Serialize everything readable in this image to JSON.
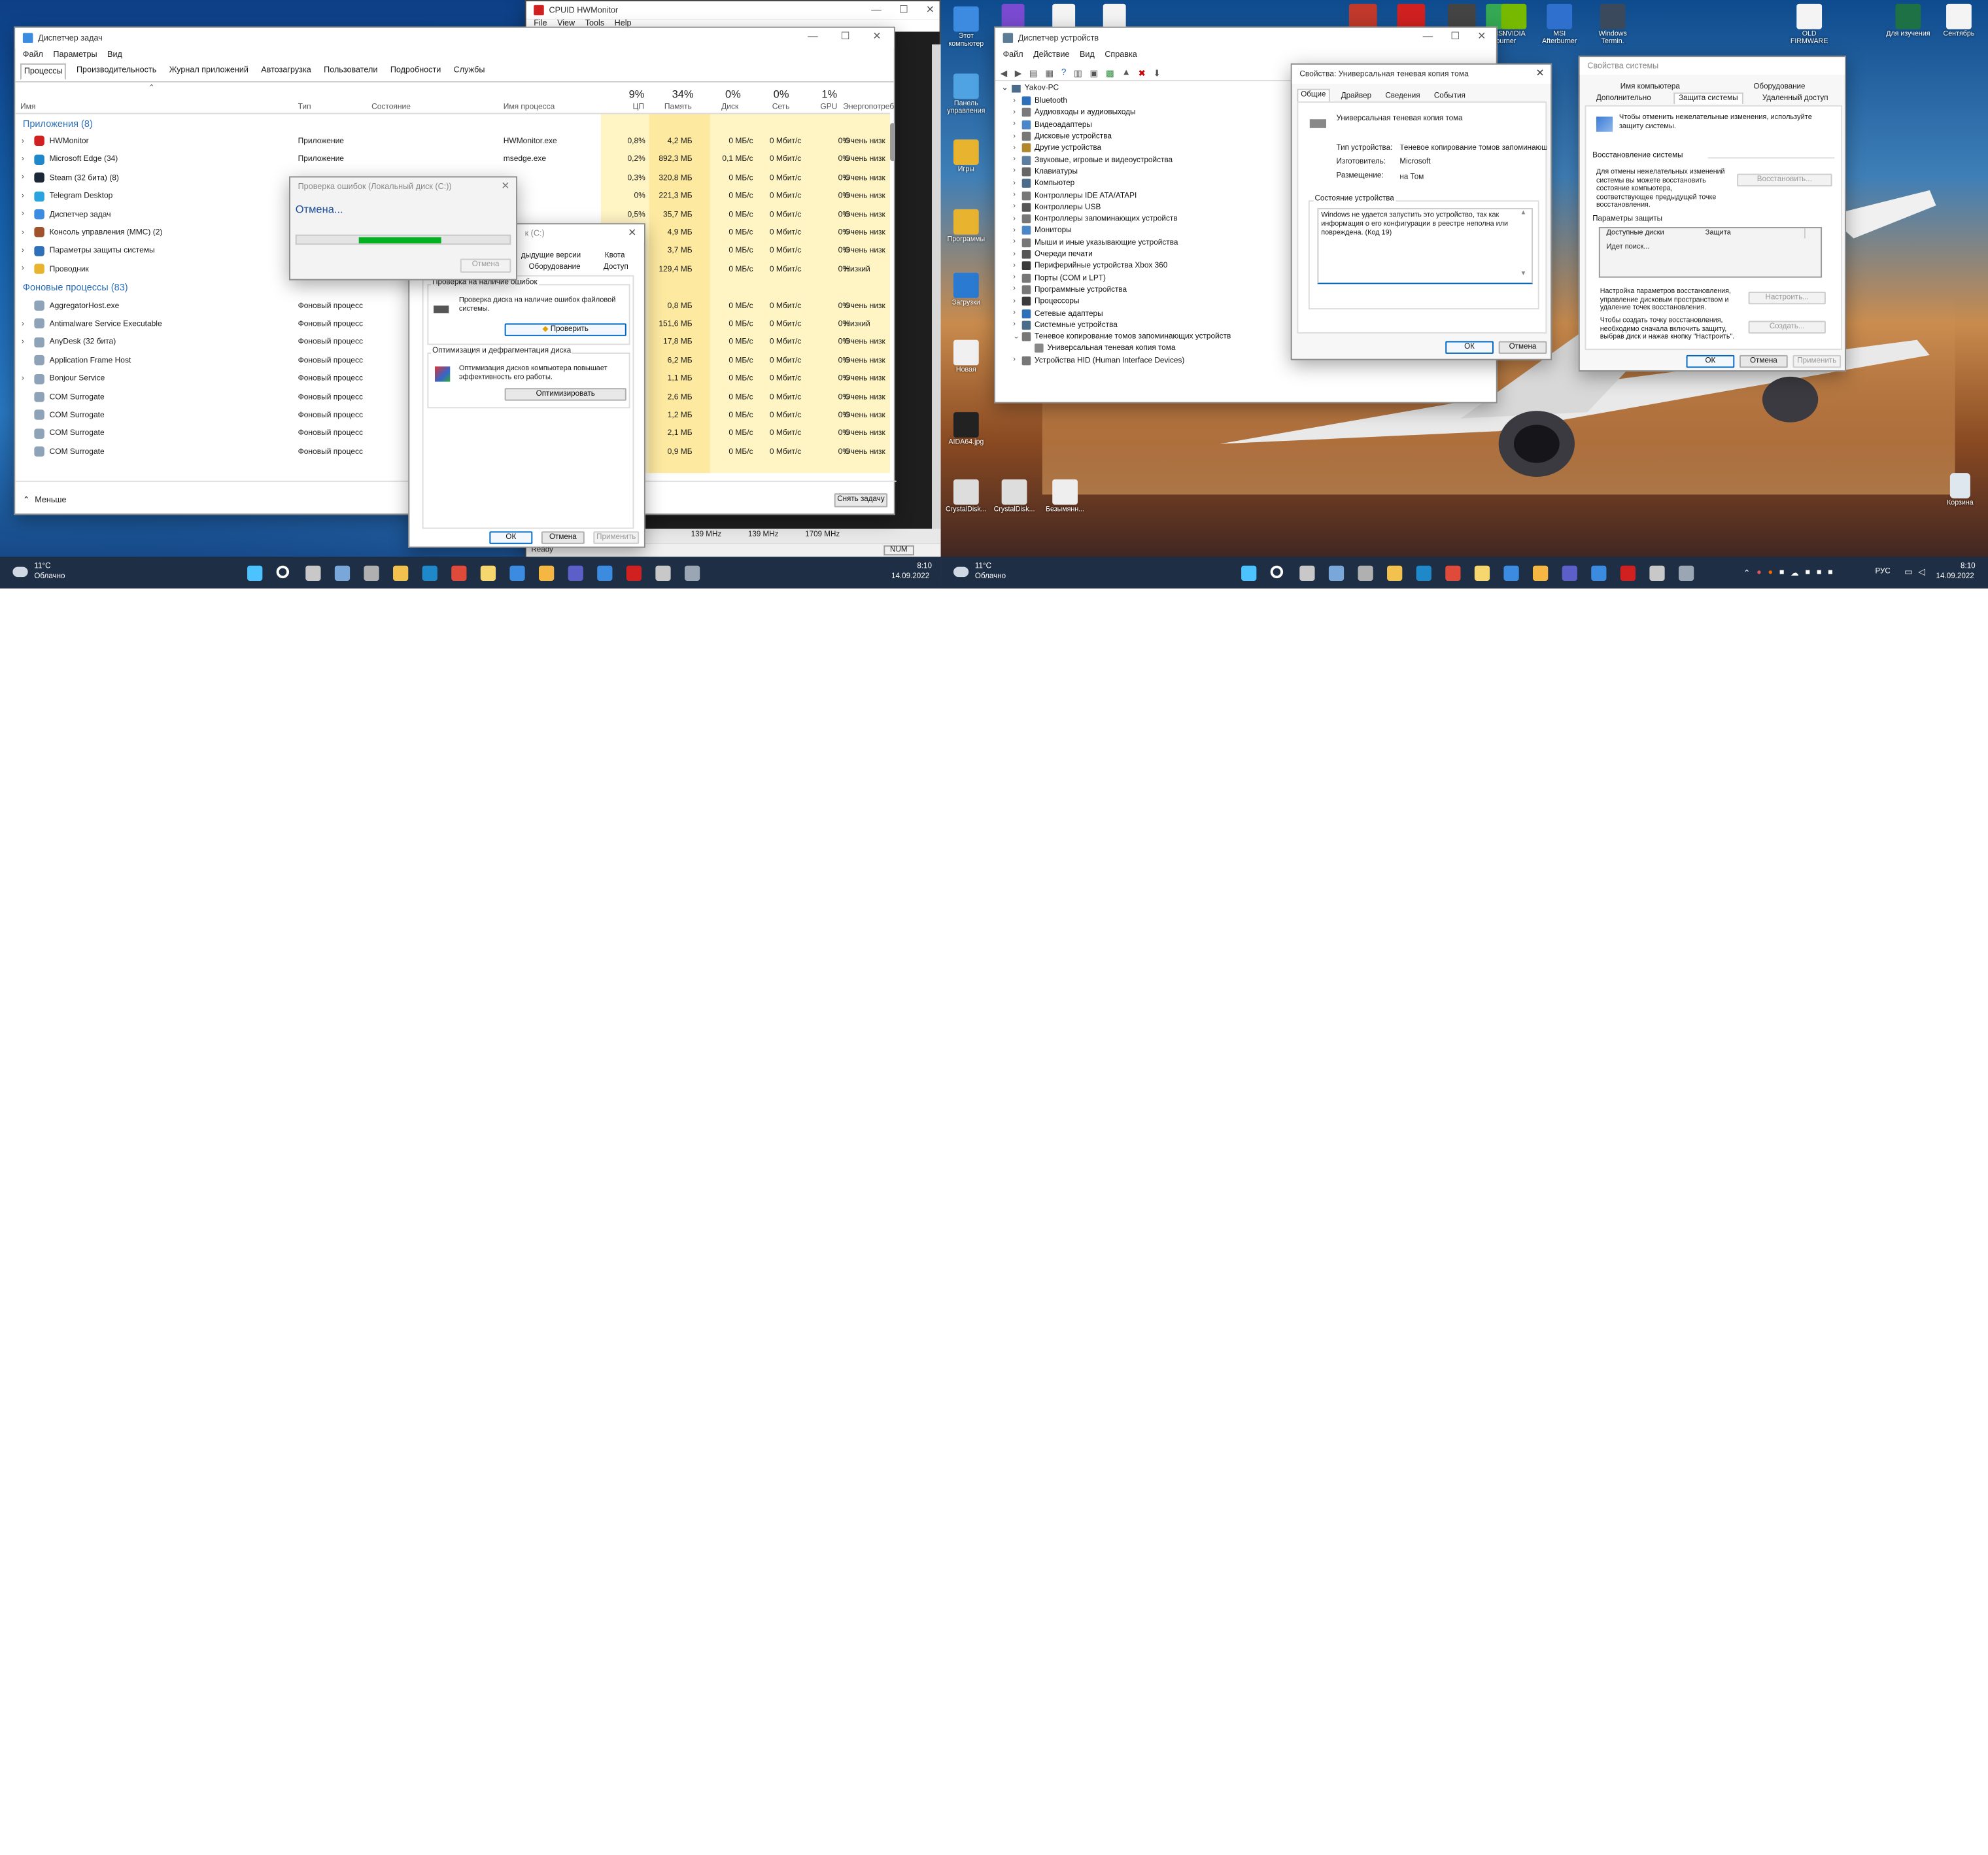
{
  "colors": {
    "accent": "#0067c0",
    "taskbar": "#1d2e45",
    "heat_light": "#fff4c4",
    "heat_mid": "#fde9a0",
    "progress_green": "#06b025",
    "section_header": "#2d6fb8"
  },
  "taskmgr": {
    "title": "Диспетчер задач",
    "menu": [
      "Файл",
      "Параметры",
      "Вид"
    ],
    "tabs": [
      "Процессы",
      "Производительность",
      "Журнал приложений",
      "Автозагрузка",
      "Пользователи",
      "Подробности",
      "Службы"
    ],
    "columns": {
      "name": "Имя",
      "type": "Тип",
      "status": "Состояние",
      "process": "Имя процесса",
      "cpu_pct": "9%",
      "cpu": "ЦП",
      "mem_pct": "34%",
      "mem": "Память",
      "disk_pct": "0%",
      "disk": "Диск",
      "net_pct": "0%",
      "net": "Сеть",
      "gpu_pct": "1%",
      "gpu": "GPU",
      "energy": "Энергопотреб"
    },
    "apps_header": "Приложения (8)",
    "bg_header": "Фоновые процессы (83)",
    "apps": [
      {
        "name": "HWMonitor",
        "type": "Приложение",
        "proc": "HWMonitor.exe",
        "cpu": "0,8%",
        "mem": "4,2 МБ",
        "disk": "0 МБ/с",
        "net": "0 Мбит/с",
        "gpu": "0%",
        "energy": "Очень низк",
        "icon": "hwmonitor-icon"
      },
      {
        "name": "Microsoft Edge (34)",
        "type": "Приложение",
        "proc": "msedge.exe",
        "cpu": "0,2%",
        "mem": "892,3 МБ",
        "disk": "0,1 МБ/с",
        "net": "0 Мбит/с",
        "gpu": "0%",
        "energy": "Очень низк",
        "icon": "edge-icon"
      },
      {
        "name": "Steam (32 бита) (8)",
        "type": "",
        "proc": "",
        "cpu": "0,3%",
        "mem": "320,8 МБ",
        "disk": "0 МБ/с",
        "net": "0 Мбит/с",
        "gpu": "0%",
        "energy": "Очень низк",
        "icon": "steam-icon"
      },
      {
        "name": "Telegram Desktop",
        "type": "",
        "proc": "",
        "cpu": "0%",
        "mem": "221,3 МБ",
        "disk": "0 МБ/с",
        "net": "0 Мбит/с",
        "gpu": "0%",
        "energy": "Очень низк",
        "icon": "telegram-icon"
      },
      {
        "name": "Диспетчер задач",
        "type": "",
        "proc": "",
        "cpu": "0,5%",
        "mem": "35,7 МБ",
        "disk": "0 МБ/с",
        "net": "0 Мбит/с",
        "gpu": "0%",
        "energy": "Очень низк",
        "icon": "taskmgr-icon"
      },
      {
        "name": "Консоль управления (MMC) (2)",
        "type": "",
        "proc": "",
        "cpu": "",
        "mem": "4,9 МБ",
        "disk": "0 МБ/с",
        "net": "0 Мбит/с",
        "gpu": "0%",
        "energy": "Очень низк",
        "icon": "mmc-icon"
      },
      {
        "name": "Параметры защиты системы",
        "type": "",
        "proc": "",
        "cpu": "",
        "mem": "3,7 МБ",
        "disk": "0 МБ/с",
        "net": "0 Мбит/с",
        "gpu": "0%",
        "energy": "Очень низк",
        "icon": "shield-icon"
      },
      {
        "name": "Проводник",
        "type": "",
        "proc": "",
        "cpu": "",
        "mem": "129,4 МБ",
        "disk": "0 МБ/с",
        "net": "0 Мбит/с",
        "gpu": "0%",
        "energy": "Низкий",
        "icon": "folder-icon"
      }
    ],
    "bg": [
      {
        "name": "AggregatorHost.exe",
        "type": "Фоновый процесс",
        "cpu": "",
        "mem": "0,8 МБ",
        "disk": "0 МБ/с",
        "net": "0 Мбит/с",
        "gpu": "0%",
        "energy": "Очень низк"
      },
      {
        "name": "Antimalware Service Executable",
        "type": "Фоновый процесс",
        "cpu": "",
        "mem": "151,6 МБ",
        "disk": "0 МБ/с",
        "net": "0 Мбит/с",
        "gpu": "0%",
        "energy": "Низкий"
      },
      {
        "name": "AnyDesk (32 бита)",
        "type": "Фоновый процесс",
        "cpu": "",
        "mem": "17,8 МБ",
        "disk": "0 МБ/с",
        "net": "0 Мбит/с",
        "gpu": "0%",
        "energy": "Очень низк"
      },
      {
        "name": "Application Frame Host",
        "type": "Фоновый процесс",
        "cpu": "",
        "mem": "6,2 МБ",
        "disk": "0 МБ/с",
        "net": "0 Мбит/с",
        "gpu": "0%",
        "energy": "Очень низк"
      },
      {
        "name": "Bonjour Service",
        "type": "Фоновый процесс",
        "cpu": "",
        "mem": "1,1 МБ",
        "disk": "0 МБ/с",
        "net": "0 Мбит/с",
        "gpu": "0%",
        "energy": "Очень низк"
      },
      {
        "name": "COM Surrogate",
        "type": "Фоновый процесс",
        "cpu": "",
        "mem": "2,6 МБ",
        "disk": "0 МБ/с",
        "net": "0 Мбит/с",
        "gpu": "0%",
        "energy": "Очень низк"
      },
      {
        "name": "COM Surrogate",
        "type": "Фоновый процесс",
        "cpu": "",
        "mem": "1,2 МБ",
        "disk": "0 МБ/с",
        "net": "0 Мбит/с",
        "gpu": "0%",
        "energy": "Очень низк"
      },
      {
        "name": "COM Surrogate",
        "type": "Фоновый процесс",
        "cpu": "",
        "mem": "2,1 МБ",
        "disk": "0 МБ/с",
        "net": "0 Мбит/с",
        "gpu": "0%",
        "energy": "Очень низк"
      },
      {
        "name": "COM Surrogate",
        "type": "Фоновый процесс",
        "cpu": "",
        "mem": "0,9 МБ",
        "disk": "0 МБ/с",
        "net": "0 Мбит/с",
        "gpu": "0%",
        "energy": "Очень низк"
      }
    ],
    "less_label": "Меньше",
    "end_task": "Снять задачу"
  },
  "hwmonitor": {
    "title": "CPUID HWMonitor",
    "menu": [
      "File",
      "View",
      "Tools",
      "Help"
    ],
    "status": "Ready",
    "num": "NUM",
    "freqs": [
      "139 MHz",
      "139 MHz",
      "1709 MHz"
    ]
  },
  "check_progress": {
    "title": "Проверка ошибок (Локальный диск (C:))",
    "status": "Отмена...",
    "progress": 0.5,
    "cancel": "Отмена"
  },
  "disk_props": {
    "title_fragment": "к (C:)",
    "tabs_row1": [
      "дыдущие версии",
      "Квота"
    ],
    "tabs_row2": [
      "Оборудование",
      "Доступ"
    ],
    "check_group": "Проверка на наличие ошибок",
    "check_desc": "Проверка диска на наличие ошибок файловой системы.",
    "check_btn": "Проверить",
    "opt_group": "Оптимизация и дефрагментация диска",
    "opt_desc": "Оптимизация дисков компьютера повышает эффективность его работы.",
    "opt_btn": "Оптимизировать",
    "ok": "ОК",
    "cancel": "Отмена",
    "apply": "Применить"
  },
  "devmgr": {
    "title": "Диспетчер устройств",
    "menu": [
      "Файл",
      "Действие",
      "Вид",
      "Справка"
    ],
    "root": "Yakov-PC",
    "items": [
      "Bluetooth",
      "Аудиовходы и аудиовыходы",
      "Видеоадаптеры",
      "Дисковые устройства",
      "Другие устройства",
      "Звуковые, игровые и видеоустройства",
      "Клавиатуры",
      "Компьютер",
      "Контроллеры IDE ATA/ATAPI",
      "Контроллеры USB",
      "Контроллеры запоминающих устройств",
      "Мониторы",
      "Мыши и иные указывающие устройства",
      "Очереди печати",
      "Периферийные устройства Xbox 360",
      "Порты (COM и LPT)",
      "Программные устройства",
      "Процессоры",
      "Сетевые адаптеры",
      "Системные устройства",
      "Теневое копирование томов запоминающих устройств",
      "Универсальная теневая копия тома",
      "Устройства HID (Human Interface Devices)"
    ]
  },
  "volprops": {
    "title": "Свойства: Универсальная теневая копия тома",
    "tabs": [
      "Общие",
      "Драйвер",
      "Сведения",
      "События"
    ],
    "device_name": "Универсальная теневая копия тома",
    "type_label": "Тип устройства:",
    "type_value": "Теневое копирование томов запоминающ",
    "maker_label": "Изготовитель:",
    "maker_value": "Microsoft",
    "place_label": "Размещение:",
    "place_value": "на Том",
    "status_group": "Состояние устройства",
    "status_text": "Windows не удается запустить это устройство, так как информация о его конфигурации в реестре неполна или повреждена. (Код 19)",
    "ok": "ОК",
    "cancel": "Отмена"
  },
  "sysprops": {
    "title": "Свойства системы",
    "tabs_row1": [
      "Имя компьютера",
      "Оборудование"
    ],
    "tabs_row2": [
      "Дополнительно",
      "Защита системы",
      "Удаленный доступ"
    ],
    "intro": "Чтобы отменить нежелательные изменения, используйте защиту системы.",
    "restore_group": "Восстановление системы",
    "restore_desc": "Для отмены нежелательных изменений системы вы можете восстановить состояние компьютера, соответствующее предыдущей точке восстановления.",
    "restore_btn": "Восстановить...",
    "protect_group": "Параметры защиты",
    "col_disks": "Доступные диски",
    "col_protect": "Защита",
    "searching": "Идет поиск...",
    "config_desc": "Настройка параметров восстановления, управление дисковым пространством и удаление точек восстановления.",
    "config_btn": "Настроить...",
    "create_desc": "Чтобы создать точку восстановления, необходимо сначала включить защиту, выбрав диск и нажав кнопку \"Настроить\".",
    "create_btn": "Создать...",
    "ok": "ОК",
    "cancel": "Отмена",
    "apply": "Применить"
  },
  "left_taskbar": {
    "weather_temp": "11°C",
    "weather_text": "Облачно",
    "time": "8:10",
    "date": "14.09.2022"
  },
  "right_taskbar": {
    "weather_temp": "11°C",
    "weather_text": "Облачно",
    "lang": "РУС",
    "time": "8:10",
    "date": "14.09.2022"
  },
  "desktop_icons_left_col": [
    "Этот компьютер",
    "Панель управления",
    "Игры",
    "Программы",
    "Загрузки",
    "Новая",
    "AIDA64.jpg",
    "CrystalDisk...",
    "CrystalDisk...",
    "Безымянн..."
  ],
  "desktop_icons_top": [
    "MSI Afterburner",
    "NVIDIA",
    "MSI Afterburner",
    "Windows Termin.",
    "OLD FIRMWARE",
    "Для изучения",
    "Сентябрь"
  ],
  "recycle_bin": "Корзина"
}
